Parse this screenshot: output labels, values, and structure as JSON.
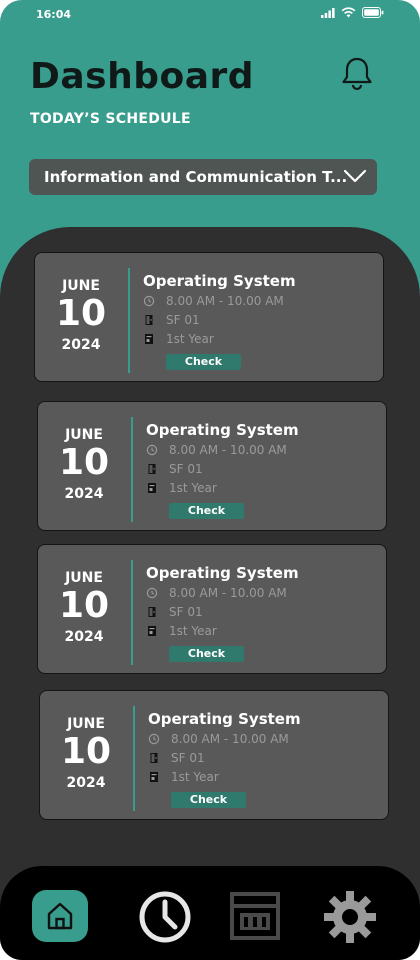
{
  "status_bar": {
    "time": "16:04",
    "icons": [
      "signal-icon",
      "wifi-icon",
      "battery-icon"
    ]
  },
  "header": {
    "title": "Dashboard",
    "subtitle": "TODAY’S SCHEDULE",
    "notification_icon": "bell-icon"
  },
  "course_select": {
    "value": "Information and Communication T...",
    "icon": "chevron-down-icon"
  },
  "schedule": [
    {
      "month": "JUNE",
      "day": "10",
      "year": "2024",
      "course": "Operating System",
      "time": "8.00 AM - 10.00 AM",
      "room": "SF 01",
      "level": "1st Year",
      "action": "Check"
    },
    {
      "month": "JUNE",
      "day": "10",
      "year": "2024",
      "course": "Operating System",
      "time": "8.00 AM - 10.00 AM",
      "room": "SF 01",
      "level": "1st Year",
      "action": "Check"
    },
    {
      "month": "JUNE",
      "day": "10",
      "year": "2024",
      "course": "Operating System",
      "time": "8.00 AM - 10.00 AM",
      "room": "SF 01",
      "level": "1st Year",
      "action": "Check"
    },
    {
      "month": "JUNE",
      "day": "10",
      "year": "2024",
      "course": "Operating System",
      "time": "8.00 AM - 10.00 AM",
      "room": "SF 01",
      "level": "1st Year",
      "action": "Check"
    }
  ],
  "bottom_nav": {
    "items": [
      {
        "icon": "home-icon",
        "active": true
      },
      {
        "icon": "clock-icon",
        "active": false
      },
      {
        "icon": "calendar-icon",
        "active": false
      },
      {
        "icon": "gear-icon",
        "active": false
      }
    ]
  },
  "colors": {
    "accent": "#399d8e",
    "panel": "#2f2f2f",
    "card": "#595959",
    "button": "#2f7a6c",
    "nav": "#000000"
  }
}
